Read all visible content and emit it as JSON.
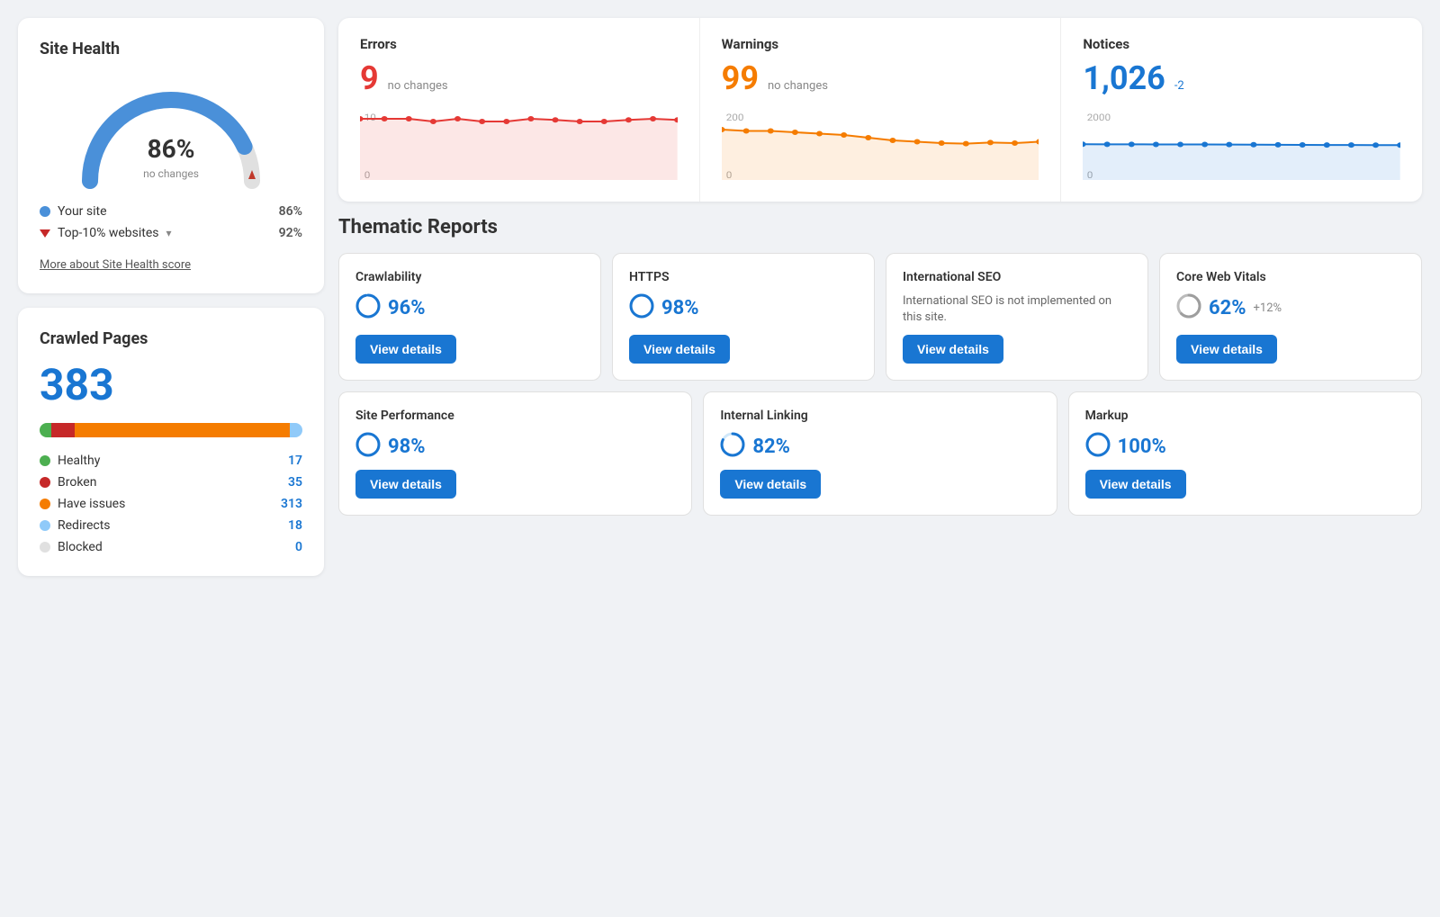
{
  "siteHealth": {
    "title": "Site Health",
    "percent": "86%",
    "sub": "no changes",
    "gaugePct": 86,
    "yourSiteLabel": "Your site",
    "yourSiteValue": "86%",
    "top10Label": "Top-10% websites",
    "top10Value": "92%",
    "moreLink": "More about Site Health score"
  },
  "errors": {
    "label": "Errors",
    "value": "9",
    "change": "no changes",
    "chartMax": 10,
    "chartMin": 0,
    "color": "#e53935",
    "bgColor": "rgba(229,57,53,0.12)",
    "points": [
      10,
      10,
      10,
      9.5,
      10,
      9.5,
      9.5,
      10,
      9.8,
      9.5,
      9.5,
      9.8,
      10,
      9.8
    ]
  },
  "warnings": {
    "label": "Warnings",
    "value": "99",
    "change": "no changes",
    "chartMax": 200,
    "chartMin": 0,
    "color": "#f57c00",
    "bgColor": "rgba(245,124,0,0.12)",
    "points": [
      160,
      155,
      155,
      150,
      145,
      140,
      130,
      120,
      115,
      110,
      108,
      112,
      110,
      115
    ]
  },
  "notices": {
    "label": "Notices",
    "value": "1,026",
    "change": "-2",
    "chartMax": 2000,
    "chartMin": 0,
    "color": "#1976d2",
    "bgColor": "rgba(25,118,210,0.12)",
    "points": [
      1060,
      1055,
      1055,
      1050,
      1048,
      1050,
      1045,
      1040,
      1038,
      1035,
      1030,
      1028,
      1026,
      1026
    ]
  },
  "thematicReports": {
    "title": "Thematic Reports",
    "row1": [
      {
        "name": "Crawlability",
        "score": "96%",
        "change": "",
        "hasButton": true,
        "desc": ""
      },
      {
        "name": "HTTPS",
        "score": "98%",
        "change": "",
        "hasButton": true,
        "desc": ""
      },
      {
        "name": "International SEO",
        "score": "",
        "change": "",
        "hasButton": true,
        "desc": "International SEO is not implemented on this site."
      },
      {
        "name": "Core Web Vitals",
        "score": "62%",
        "change": "+12%",
        "hasButton": true,
        "desc": ""
      }
    ],
    "row2": [
      {
        "name": "Site Performance",
        "score": "98%",
        "change": "",
        "hasButton": true,
        "desc": ""
      },
      {
        "name": "Internal Linking",
        "score": "82%",
        "change": "",
        "hasButton": true,
        "desc": ""
      },
      {
        "name": "Markup",
        "score": "100%",
        "change": "",
        "hasButton": true,
        "desc": ""
      }
    ],
    "viewButtonLabel": "View details"
  },
  "crawledPages": {
    "title": "Crawled Pages",
    "count": "383",
    "bars": [
      {
        "label": "Healthy",
        "color": "#4caf50",
        "pct": 4.4,
        "count": "17"
      },
      {
        "label": "Broken",
        "color": "#c62828",
        "pct": 9.1,
        "count": "35"
      },
      {
        "label": "Have issues",
        "color": "#f57c00",
        "pct": 81.7,
        "count": "313"
      },
      {
        "label": "Redirects",
        "color": "#90caf9",
        "pct": 4.7,
        "count": "18"
      },
      {
        "label": "Blocked",
        "color": "#e0e0e0",
        "pct": 0.1,
        "count": "0"
      }
    ]
  }
}
